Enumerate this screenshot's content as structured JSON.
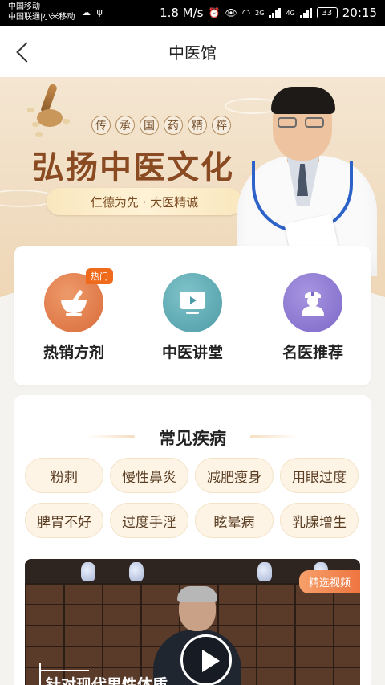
{
  "status_bar": {
    "carrier_1": "中国移动",
    "carrier_2": "中国联通|小米移动",
    "speed": "1.8 M/s",
    "network_1": "2G",
    "network_2": "4G",
    "battery": "33",
    "time": "20:15"
  },
  "header": {
    "title": "中医馆"
  },
  "banner": {
    "motto_chars": [
      "传",
      "承",
      "国",
      "药",
      "精",
      "粹"
    ],
    "slogan": "弘扬中医文化",
    "pill_text": "仁德为先 · 大医精诚"
  },
  "quick_nav": {
    "items": [
      {
        "label": "热销方剂",
        "badge": "热门",
        "icon": "mortar-pestle-icon"
      },
      {
        "label": "中医讲堂",
        "icon": "video-screen-icon"
      },
      {
        "label": "名医推荐",
        "icon": "doctor-icon"
      }
    ]
  },
  "diseases": {
    "title": "常见疾病",
    "tags": [
      "粉刺",
      "慢性鼻炎",
      "减肥瘦身",
      "用眼过度",
      "脾胃不好",
      "过度手淫",
      "眩晕病",
      "乳腺增生"
    ]
  },
  "video": {
    "badge": "精选视频",
    "caption": "针对现代男性体质"
  },
  "colors": {
    "accent": "#ee7540",
    "slogan": "#8a4b22",
    "tag_bg": "#fdf4e6"
  }
}
